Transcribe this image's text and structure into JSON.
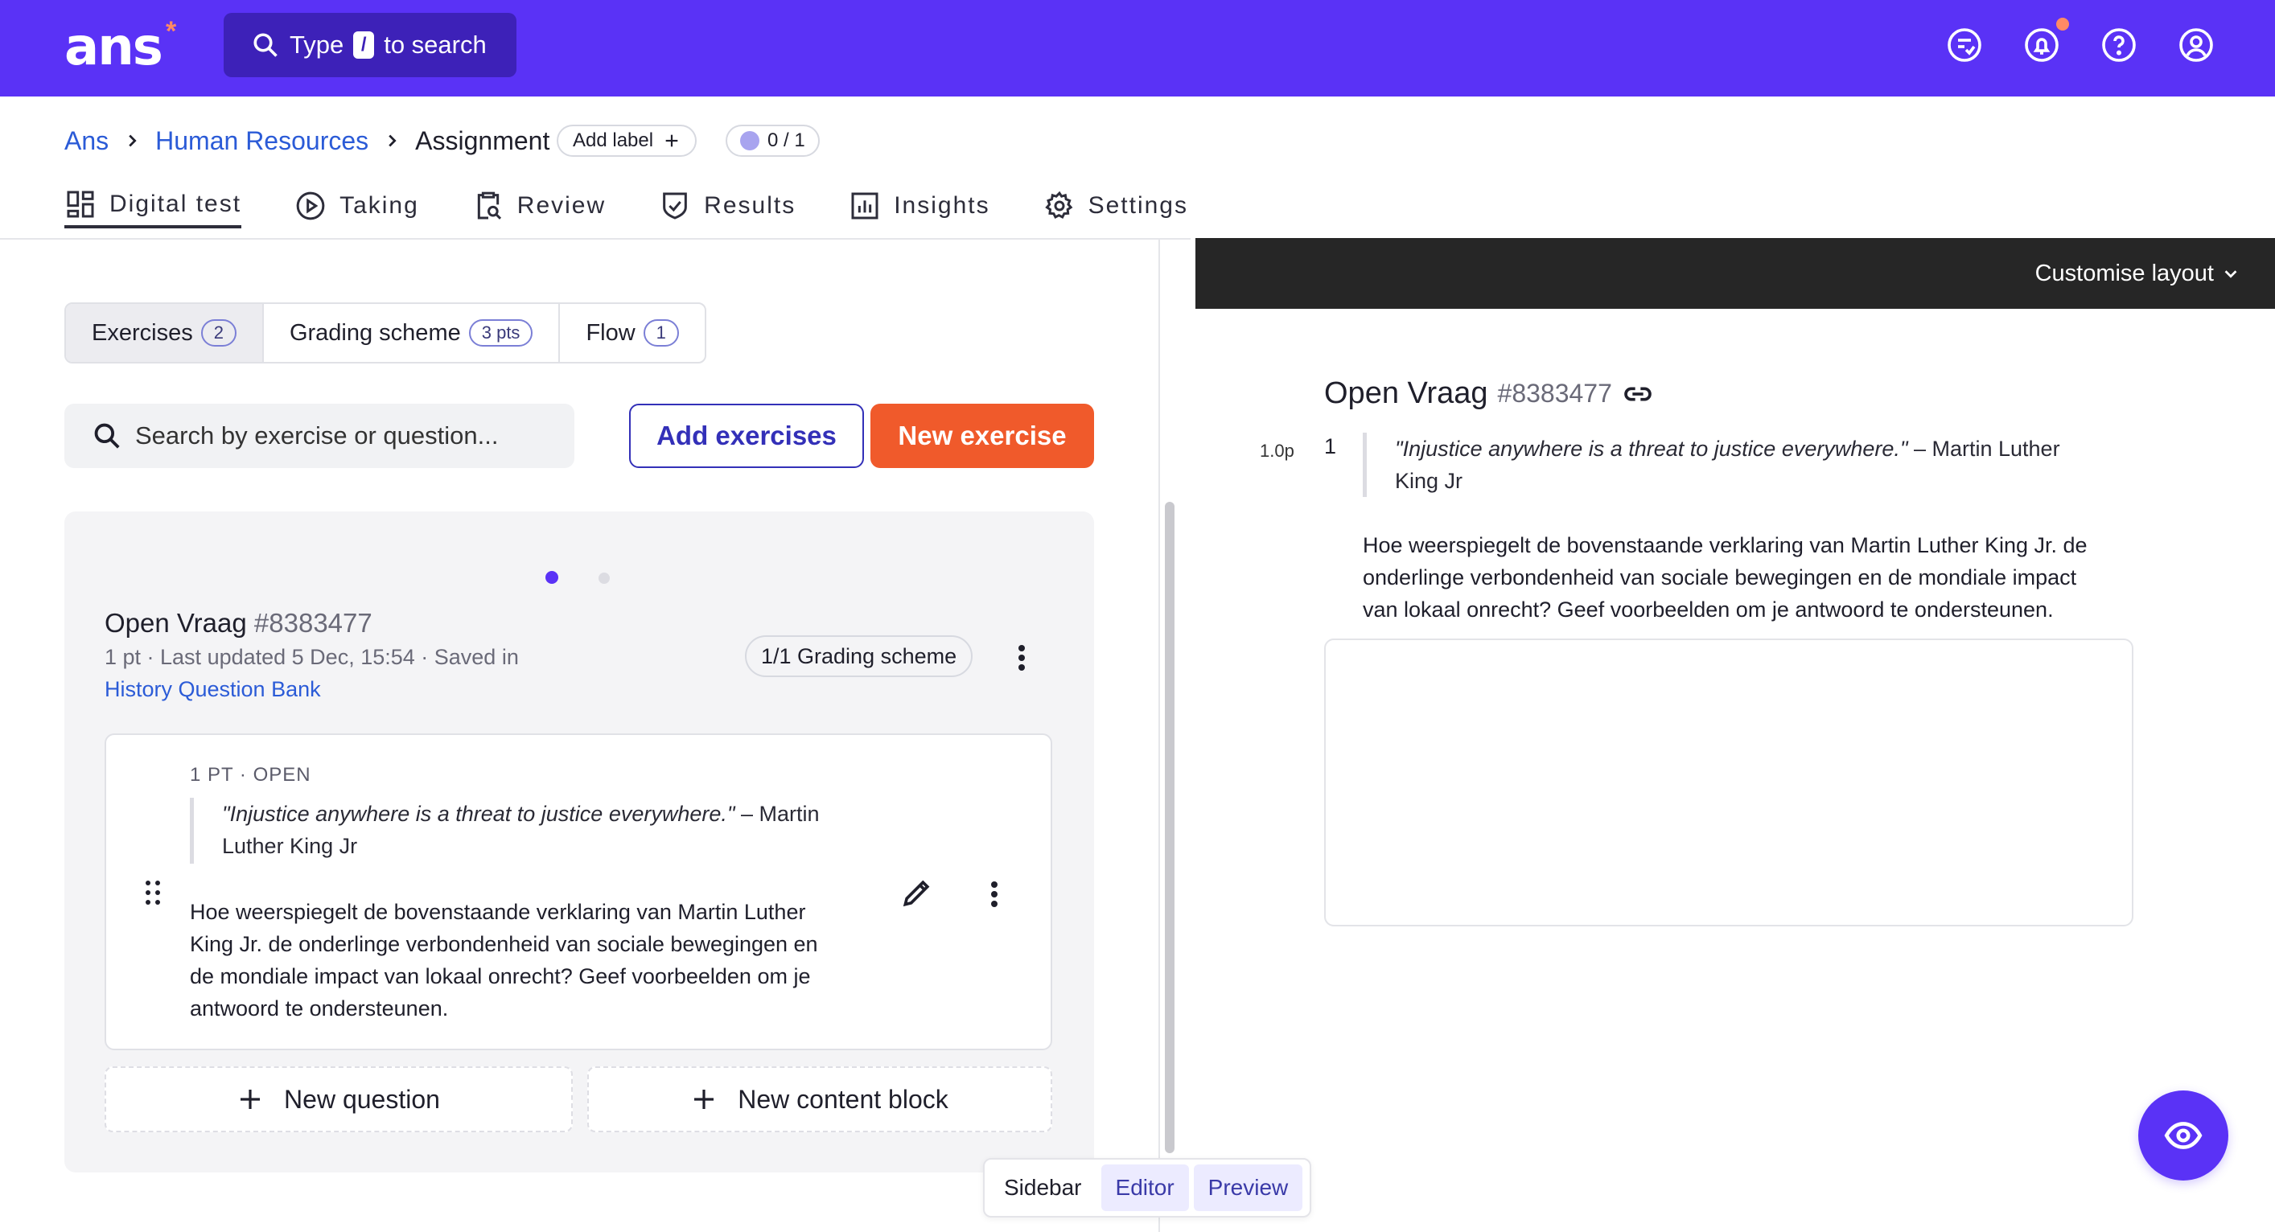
{
  "app": {
    "logo_text": "ans",
    "logo_mark": "*",
    "search": {
      "prefix": "Type",
      "key": "/",
      "suffix": "to search"
    },
    "top_icons": [
      "checklist-icon",
      "bell-icon",
      "help-icon",
      "account-icon"
    ]
  },
  "breadcrumb": {
    "items": [
      "Ans",
      "Human Resources"
    ],
    "current": "Assignment",
    "add_label": "Add label",
    "progress": "0 / 1"
  },
  "nav_tabs": [
    {
      "label": "Digital test",
      "icon": "grid-icon",
      "active": true
    },
    {
      "label": "Taking",
      "icon": "play-icon"
    },
    {
      "label": "Review",
      "icon": "clipboard-search-icon"
    },
    {
      "label": "Results",
      "icon": "shield-check-icon"
    },
    {
      "label": "Insights",
      "icon": "bar-chart-icon"
    },
    {
      "label": "Settings",
      "icon": "gear-icon"
    }
  ],
  "subtabs": [
    {
      "label": "Exercises",
      "badge": "2",
      "active": true
    },
    {
      "label": "Grading scheme",
      "badge": "3 pts"
    },
    {
      "label": "Flow",
      "badge": "1"
    }
  ],
  "left_search": {
    "placeholder": "Search by exercise or question..."
  },
  "buttons": {
    "add_exercises": "Add exercises",
    "new_exercise": "New exercise"
  },
  "exercise": {
    "title": "Open Vraag",
    "id": "#8383477",
    "meta": "1 pt · Last updated 5 Dec, 15:54 · Saved in",
    "bank": "History Question Bank",
    "grading": "1/1 Grading scheme",
    "question": {
      "type_label": "1 PT · OPEN",
      "quote_italic": "\"Injustice anywhere is a threat to justice everywhere.\"",
      "quote_author_left": " – Martin",
      "quote_author_left_line2": "Luther King Jr",
      "body_lines": [
        "Hoe weerspiegelt de bovenstaande verklaring van Martin Luther",
        "King Jr. de onderlinge verbondenheid van sociale bewegingen en",
        "de mondiale impact van lokaal onrecht? Geef voorbeelden om je",
        "antwoord te ondersteunen."
      ]
    },
    "new_question": "New question",
    "new_content_block": "New content block"
  },
  "preview": {
    "customise_layout": "Customise layout",
    "title": "Open Vraag",
    "id": "#8383477",
    "points": "1.0p",
    "number": "1",
    "quote_italic": "\"Injustice anywhere is a threat to justice everywhere.\"",
    "quote_author": " – Martin Luther",
    "quote_author_line2": "King Jr",
    "body_lines": [
      "Hoe weerspiegelt de bovenstaande verklaring van Martin Luther King Jr. de",
      "onderlinge verbondenheid van sociale bewegingen en de mondiale impact",
      "van lokaal onrecht? Geef voorbeelden om je antwoord te ondersteunen."
    ]
  },
  "view_toggle": {
    "sidebar": "Sidebar",
    "editor": "Editor",
    "preview": "Preview"
  },
  "colors": {
    "brand": "#5a32f6",
    "accent": "#f05a2b",
    "link": "#2b5bd7"
  }
}
